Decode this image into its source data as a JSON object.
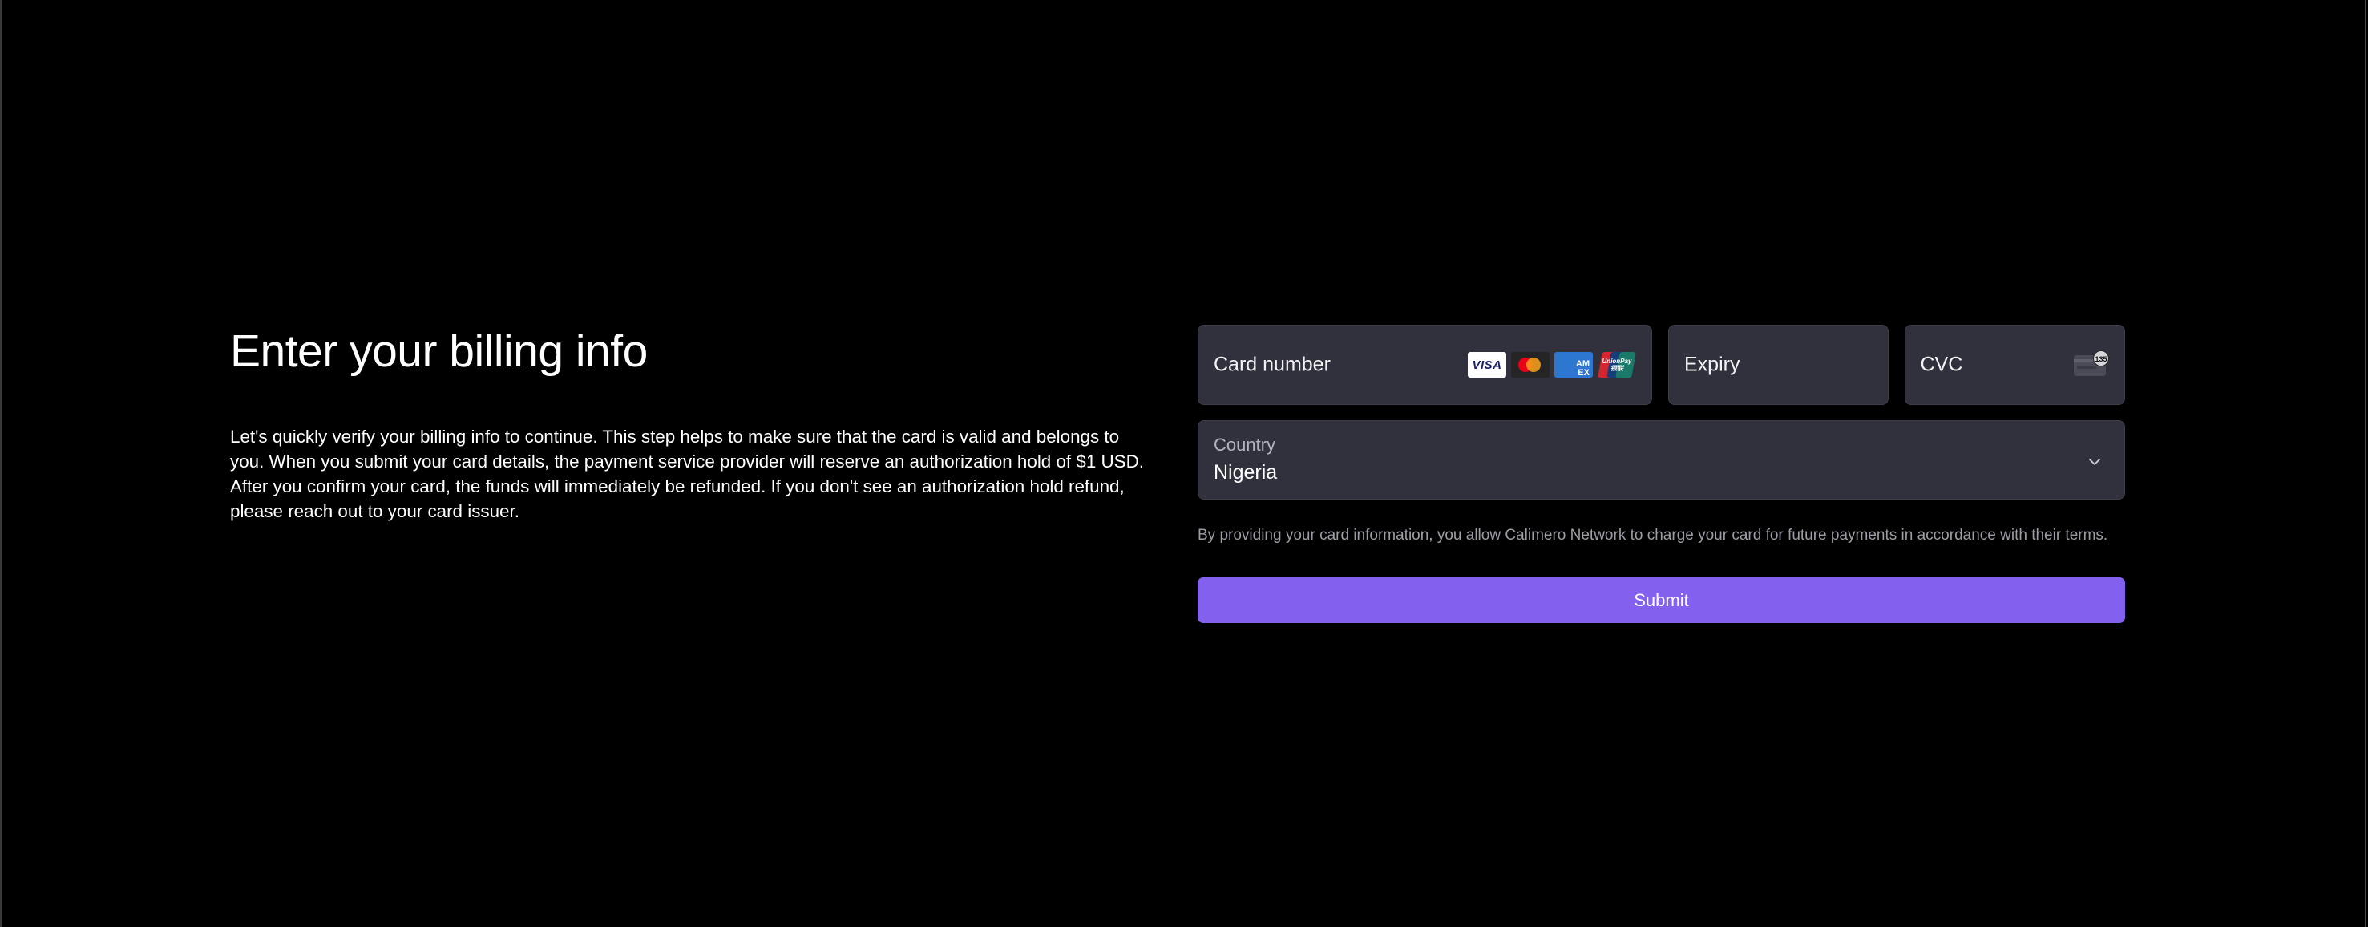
{
  "intro": {
    "title": "Enter your billing info",
    "description": "Let's quickly verify your billing info to continue. This step helps to make sure that the card is valid and belongs to you. When you submit your card details, the payment service provider will reserve an authorization hold of $1 USD. After you confirm your card, the funds will immediately be refunded. If you don't see an authorization hold refund, please reach out to your card issuer."
  },
  "form": {
    "card_number": {
      "placeholder": "Card number",
      "value": "",
      "brands": [
        {
          "name": "visa",
          "label": "VISA"
        },
        {
          "name": "mastercard",
          "label": ""
        },
        {
          "name": "amex",
          "label_top": "AM",
          "label_bottom": "EX"
        },
        {
          "name": "unionpay",
          "label_top": "UnionPay",
          "label_bottom": "银联"
        }
      ]
    },
    "expiry": {
      "placeholder": "Expiry",
      "value": ""
    },
    "cvc": {
      "placeholder": "CVC",
      "value": "",
      "icon": "cvc-card-icon",
      "icon_badge": "135"
    },
    "country": {
      "label": "Country",
      "selected": "Nigeria",
      "icon": "chevron-down-icon"
    },
    "terms": "By providing your card information, you allow Calimero Network to charge your card for future payments in accordance with their terms.",
    "submit_label": "Submit"
  },
  "colors": {
    "background": "#000000",
    "field_background": "#31313d",
    "accent": "#8360ee",
    "muted_text": "#9d9da6"
  }
}
